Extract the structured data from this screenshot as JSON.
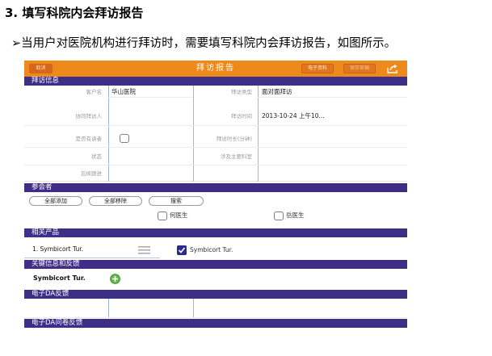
{
  "doc": {
    "heading": "3. 填写科院内会拜访报告",
    "intro_arrow": "➢",
    "intro": "当用户对医院机构进行拜访时，需要填写科院内会拜访报告，如图所示。"
  },
  "app": {
    "topbar": {
      "title": "拜访报告",
      "back_label": "取消",
      "btn1_label": "电子资料",
      "btn2_label": "保存草稿",
      "share_icon": "share-icon",
      "color": "#ee8a1c"
    },
    "section_color": "#3f2e86",
    "visit_info": {
      "section_title": "拜访信息",
      "fields": [
        {
          "label": "客户名",
          "value": "华山医院"
        },
        {
          "label": "拜访类型",
          "value": "面对面拜访"
        },
        {
          "label": "协同拜访人",
          "value": ""
        },
        {
          "label": "拜访时间",
          "value": "2013-10-24 上午10..."
        },
        {
          "label": "是否有讲者",
          "value": ""
        },
        {
          "label": "拜访时长(分钟)",
          "value": ""
        },
        {
          "label": "状态",
          "value": ""
        },
        {
          "label": "涉及主要科室",
          "value": ""
        },
        {
          "label": "后续跟进",
          "value": ""
        }
      ]
    },
    "attendees": {
      "section_title": "参会者",
      "add_all": "全部添加",
      "remove_all": "全部移除",
      "search": "搜索",
      "people": [
        "何医生",
        "岳医生"
      ]
    },
    "products": {
      "section_title": "相关产品",
      "item_label": "1.  Symbicort Tur.",
      "checked_label": "Symbicort Tur.",
      "checked": true
    },
    "key_info": {
      "section_title": "关键信息和反馈",
      "product": "Symbicort Tur."
    },
    "eda_feedback": {
      "section_title": "电子DA反馈"
    },
    "eda_survey": {
      "section_title": "电子DA问卷反馈"
    }
  }
}
